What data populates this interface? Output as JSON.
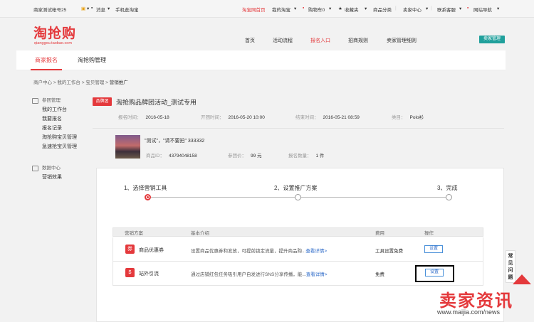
{
  "topbar": {
    "account": "商家测试帐号25",
    "messages": "消息",
    "mobile": "手机逛淘宝",
    "taobao_home": "淘宝网首页",
    "my_taobao": "我的淘宝",
    "cart": "购物车0",
    "favorites": "收藏夹",
    "categories": "商品分类",
    "seller_center": "卖家中心",
    "service": "联系客服",
    "site_nav": "网站导航"
  },
  "header": {
    "logo": "淘抢购",
    "logo_sub": "qianggou.taobao.com",
    "nav": [
      "首页",
      "活动流程",
      "报名入口",
      "招商规则",
      "卖家管理细则"
    ],
    "active_nav": "报名入口",
    "manage_button": "卖家管理"
  },
  "tabs": [
    "商家报名",
    "淘抢购管理"
  ],
  "breadcrumb": {
    "items": [
      "商户中心",
      "我的工作台",
      "宝贝管理"
    ],
    "current": "营销推广",
    "sep": ">"
  },
  "sidebar": {
    "group1_title": "参团管理",
    "group1_items": [
      "我的工作台",
      "我要报名",
      "报名记录",
      "淘抢购宝贝管理",
      "急速抢宝贝管理"
    ],
    "group2_title": "数据中心",
    "group2_items": [
      "营销效果"
    ]
  },
  "activity": {
    "tag": "品牌团",
    "title": "淘抢购品牌团活动_测试专用",
    "signup_label": "报名时间：",
    "signup_date": "2016-05-18",
    "start_label": "开团时间：",
    "start_time": "2016-05-20 10:00",
    "end_label": "结束时间：",
    "end_time": "2016-05-21 08:59",
    "category_label": "类目：",
    "category": "Polo衫"
  },
  "product": {
    "name": "\"测试\"，\"请不要拍\" 333332",
    "id_label": "商品ID：",
    "id": "43794048158",
    "price_label": "参团价：",
    "price": "99 元",
    "qty_label": "报名数量：",
    "qty": "1 件"
  },
  "steps": [
    "1、选择营销工具",
    "2、设置推广方案",
    "3、完成"
  ],
  "table": {
    "headers": [
      "营销方案",
      "基本介绍",
      "费用",
      "操作"
    ],
    "rows": [
      {
        "icon": "coupon-icon",
        "icon_glyph": "券",
        "name": "商品优惠券",
        "desc": "设置商品优惠券和发放，可提前锁定流量，提升商品购...",
        "more": "查看详情>",
        "fee": "工具设置免费",
        "action": "设置"
      },
      {
        "icon": "money-bag-icon",
        "icon_glyph": "$",
        "name": "站外引流",
        "desc": "通过店铺红包任务吸引用户自发进行SNS分享传播，能...",
        "more": "查看详情>",
        "fee": "免费",
        "action": "设置"
      }
    ]
  },
  "float_help": "常见问题",
  "watermark": {
    "text": "卖家资讯",
    "url": "www.maijia.com/news"
  },
  "colors": {
    "accent": "#e4393c",
    "teal": "#20a09c",
    "link": "#2a68c8"
  }
}
